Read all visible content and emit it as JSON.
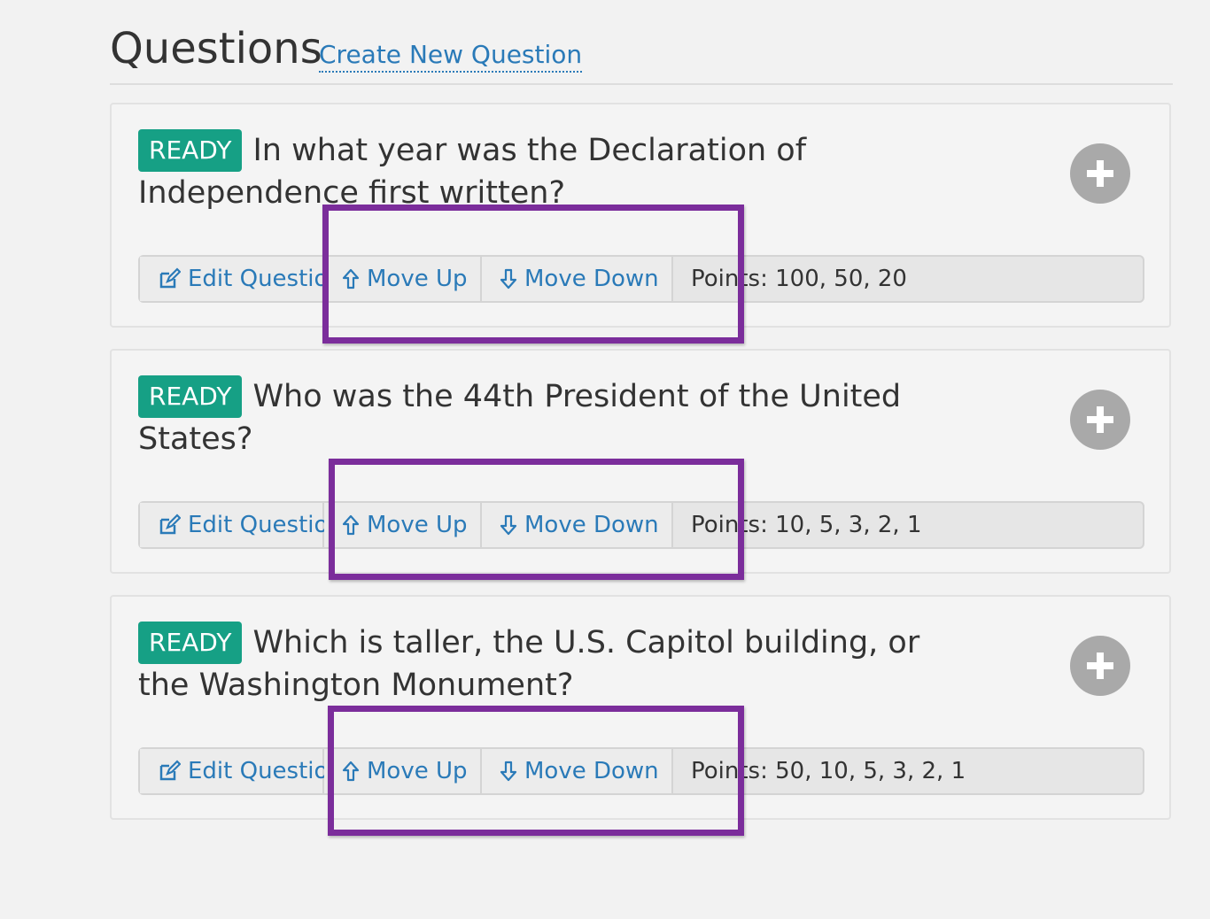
{
  "header": {
    "title": "Questions",
    "create_link": "Create New Question"
  },
  "questions": [
    {
      "status": "READY",
      "text": "In what year was the Declaration of Independence first written?",
      "actions": {
        "edit": "Edit Question",
        "up": "Move Up",
        "down": "Move Down"
      },
      "points": "Points: 100, 50, 20"
    },
    {
      "status": "READY",
      "text": "Who was the 44th President of the United States?",
      "actions": {
        "edit": "Edit Question",
        "up": "Move Up",
        "down": "Move Down"
      },
      "points": "Points: 10, 5, 3, 2, 1"
    },
    {
      "status": "READY",
      "text": "Which is taller, the U.S. Capitol building, or the Washington Monument?",
      "actions": {
        "edit": "Edit Question",
        "up": "Move Up",
        "down": "Move Down"
      },
      "points": "Points: 50, 10, 5, 3, 2, 1"
    }
  ],
  "icons": {
    "edit": "edit-icon",
    "up": "arrow-up-icon",
    "down": "arrow-down-icon",
    "add": "plus-circle-icon"
  },
  "colors": {
    "badge": "#16a085",
    "link": "#2a7ab8",
    "highlight": "#7b2d9b",
    "add_button": "#a9a9a9"
  }
}
